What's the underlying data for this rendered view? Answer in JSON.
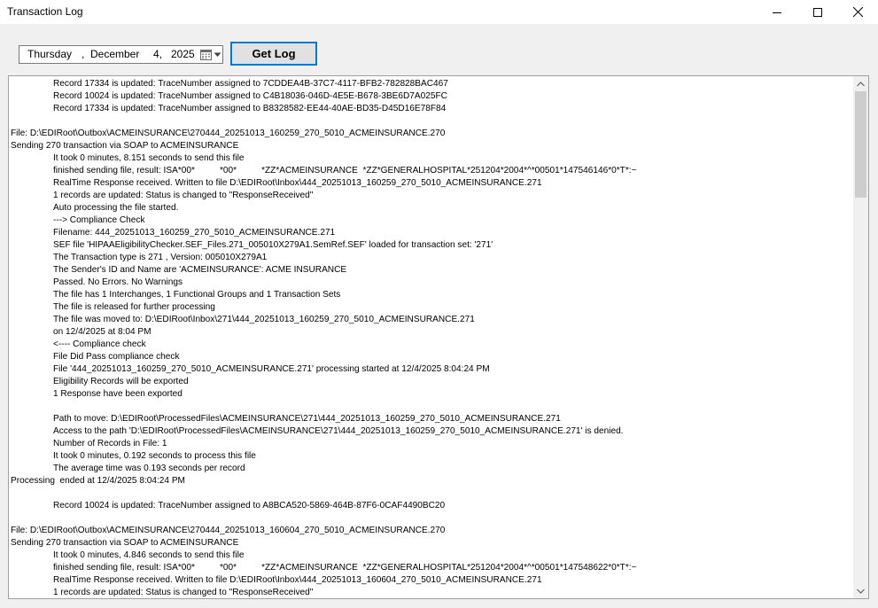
{
  "window": {
    "title": "Transaction Log"
  },
  "toolbar": {
    "date": {
      "weekday": "Thursday",
      "separator": ",",
      "month": "December",
      "day": "4,",
      "year": "2025"
    },
    "get_log_label": "Get Log"
  },
  "icons": {
    "minimize": "minimize-icon",
    "maximize": "maximize-icon",
    "close": "close-icon",
    "calendar": "calendar-dropdown-icon",
    "scroll_up": "scroll-up-arrow",
    "scroll_down": "scroll-down-arrow"
  },
  "colors": {
    "accent": "#0078d7",
    "background": "#f0f0f0"
  },
  "log": {
    "lines": [
      {
        "indent": true,
        "text": "Record 17334 is updated: TraceNumber assigned to 7CDDEA4B-37C7-4117-BFB2-782828BAC467"
      },
      {
        "indent": true,
        "text": "Record 10024 is updated: TraceNumber assigned to C4B18036-046D-4E5E-B678-3BE6D7A025FC"
      },
      {
        "indent": true,
        "text": "Record 17334 is updated: TraceNumber assigned to B8328582-EE44-40AE-BD35-D45D16E78F84"
      },
      {
        "indent": false,
        "text": ""
      },
      {
        "indent": false,
        "text": "File: D:\\EDIRoot\\Outbox\\ACMEINSURANCE\\270444_20251013_160259_270_5010_ACMEINSURANCE.270"
      },
      {
        "indent": false,
        "text": "Sending 270 transaction via SOAP to ACMEINSURANCE"
      },
      {
        "indent": true,
        "text": "It took 0 minutes, 8.151 seconds to send this file"
      },
      {
        "indent": true,
        "text": "finished sending file, result: ISA*00*          *00*          *ZZ*ACMEINSURANCE  *ZZ*GENERALHOSPITAL*251204*2004*^*00501*147546146*0*T*:~"
      },
      {
        "indent": true,
        "text": "RealTime Response received. Written to file D:\\EDIRoot\\Inbox\\444_20251013_160259_270_5010_ACMEINSURANCE.271"
      },
      {
        "indent": true,
        "text": "1 records are updated: Status is changed to \"ResponseReceived\""
      },
      {
        "indent": true,
        "text": "Auto processing the file started."
      },
      {
        "indent": true,
        "text": "---> Compliance Check"
      },
      {
        "indent": true,
        "text": "Filename: 444_20251013_160259_270_5010_ACMEINSURANCE.271"
      },
      {
        "indent": true,
        "text": "SEF file 'HIPAAEligibilityChecker.SEF_Files.271_005010X279A1.SemRef.SEF' loaded for transaction set: '271'"
      },
      {
        "indent": true,
        "text": "The Transaction type is 271 , Version: 005010X279A1"
      },
      {
        "indent": true,
        "text": "The Sender's ID and Name are 'ACMEINSURANCE': ACME INSURANCE"
      },
      {
        "indent": true,
        "text": "Passed. No Errors. No Warnings"
      },
      {
        "indent": true,
        "text": "The file has 1 Interchanges, 1 Functional Groups and 1 Transaction Sets"
      },
      {
        "indent": true,
        "text": "The file is released for further processing"
      },
      {
        "indent": true,
        "text": "The file was moved to: D:\\EDIRoot\\Inbox\\271\\444_20251013_160259_270_5010_ACMEINSURANCE.271"
      },
      {
        "indent": true,
        "text": "on 12/4/2025 at 8:04 PM"
      },
      {
        "indent": true,
        "text": "<---- Compliance check"
      },
      {
        "indent": true,
        "text": "File Did Pass compliance check"
      },
      {
        "indent": true,
        "text": "File '444_20251013_160259_270_5010_ACMEINSURANCE.271' processing started at 12/4/2025 8:04:24 PM"
      },
      {
        "indent": true,
        "text": "Eligibility Records will be exported"
      },
      {
        "indent": true,
        "text": "1 Response have been exported"
      },
      {
        "indent": false,
        "text": ""
      },
      {
        "indent": true,
        "text": "Path to move: D:\\EDIRoot\\ProcessedFiles\\ACMEINSURANCE\\271\\444_20251013_160259_270_5010_ACMEINSURANCE.271"
      },
      {
        "indent": true,
        "text": "Access to the path 'D:\\EDIRoot\\ProcessedFiles\\ACMEINSURANCE\\271\\444_20251013_160259_270_5010_ACMEINSURANCE.271' is denied."
      },
      {
        "indent": true,
        "text": "Number of Records in File: 1"
      },
      {
        "indent": true,
        "text": "It took 0 minutes, 0.192 seconds to process this file"
      },
      {
        "indent": true,
        "text": "The average time was 0.193 seconds per record"
      },
      {
        "indent": false,
        "text": "Processing  ended at 12/4/2025 8:04:24 PM"
      },
      {
        "indent": false,
        "text": ""
      },
      {
        "indent": true,
        "text": "Record 10024 is updated: TraceNumber assigned to A8BCA520-5869-464B-87F6-0CAF4490BC20"
      },
      {
        "indent": false,
        "text": ""
      },
      {
        "indent": false,
        "text": "File: D:\\EDIRoot\\Outbox\\ACMEINSURANCE\\270444_20251013_160604_270_5010_ACMEINSURANCE.270"
      },
      {
        "indent": false,
        "text": "Sending 270 transaction via SOAP to ACMEINSURANCE"
      },
      {
        "indent": true,
        "text": "It took 0 minutes, 4.846 seconds to send this file"
      },
      {
        "indent": true,
        "text": "finished sending file, result: ISA*00*          *00*          *ZZ*ACMEINSURANCE  *ZZ*GENERALHOSPITAL*251204*2004*^*00501*147548622*0*T*:~"
      },
      {
        "indent": true,
        "text": "RealTime Response received. Written to file D:\\EDIRoot\\Inbox\\444_20251013_160604_270_5010_ACMEINSURANCE.271"
      },
      {
        "indent": true,
        "text": "1 records are updated: Status is changed to \"ResponseReceived\""
      }
    ]
  }
}
